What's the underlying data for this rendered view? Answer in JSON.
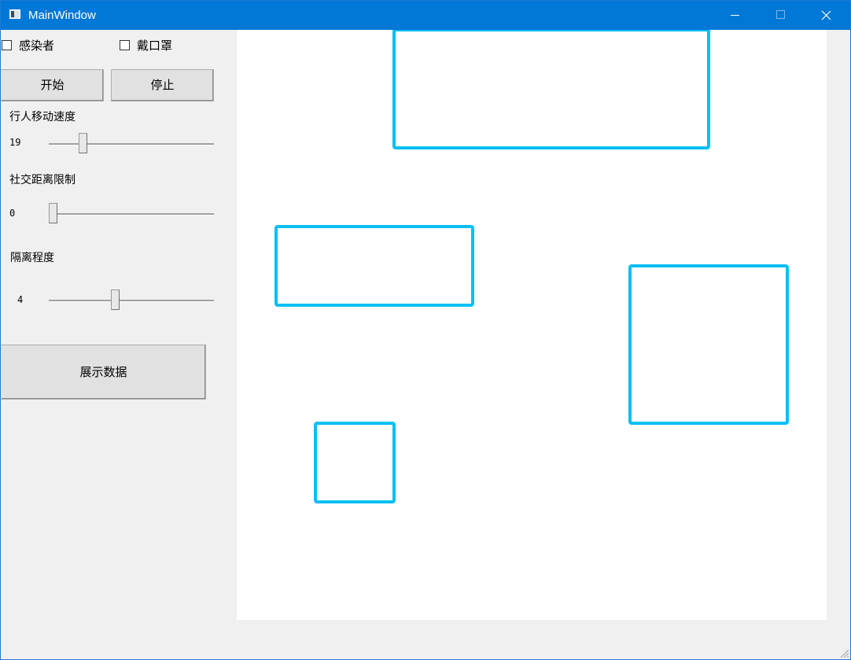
{
  "window": {
    "title": "MainWindow"
  },
  "controls": {
    "checkbox_infected": {
      "label": "感染者",
      "checked": false
    },
    "checkbox_mask": {
      "label": "戴口罩",
      "checked": false
    },
    "start_label": "开始",
    "stop_label": "停止",
    "speed": {
      "label": "行人移动速度",
      "value": 19,
      "display": "19",
      "min": 0,
      "max": 99
    },
    "distance": {
      "label": "社交距离限制",
      "value": 0,
      "display": "0",
      "min": 0,
      "max": 99
    },
    "isolation": {
      "label": "隔离程度",
      "value": 4,
      "display": "4",
      "min": 0,
      "max": 10
    },
    "show_data_label": "展示数据"
  },
  "canvas": {
    "background": "#ffffff",
    "zone_color": "#0bbff2"
  },
  "colors": {
    "titlebar": "#0078d7",
    "window_bg": "#f0f0f0"
  }
}
